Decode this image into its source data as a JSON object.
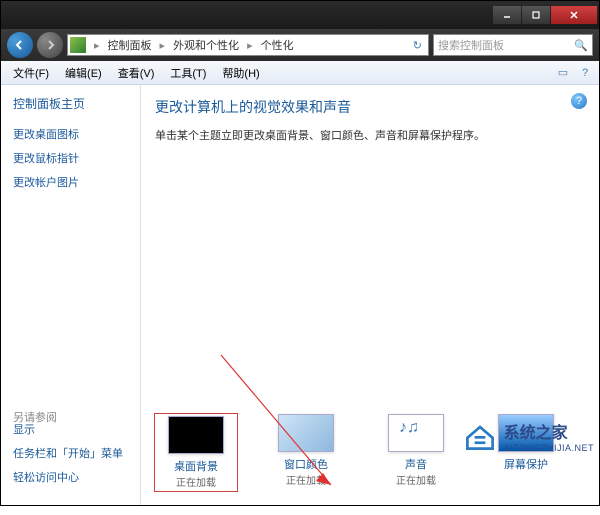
{
  "titlebar": {},
  "nav": {
    "breadcrumb": {
      "root_icon": "control-panel",
      "items": [
        "控制面板",
        "外观和个性化",
        "个性化"
      ]
    },
    "search_placeholder": "搜索控制面板"
  },
  "menubar": {
    "items": [
      "文件(F)",
      "编辑(E)",
      "查看(V)",
      "工具(T)",
      "帮助(H)"
    ]
  },
  "sidebar": {
    "home": "控制面板主页",
    "links": [
      "更改桌面图标",
      "更改鼠标指针",
      "更改帐户图片"
    ],
    "see_also_label": "另请参阅",
    "see_also": [
      "显示",
      "任务栏和「开始」菜单",
      "轻松访问中心"
    ]
  },
  "main": {
    "heading": "更改计算机上的视觉效果和声音",
    "description": "单击某个主题立即更改桌面背景、窗口颜色、声音和屏幕保护程序。",
    "tiles": [
      {
        "label": "桌面背景",
        "status": "正在加载"
      },
      {
        "label": "窗口颜色",
        "status": "正在加载"
      },
      {
        "label": "声音",
        "status": "正在加载"
      },
      {
        "label": "屏幕保护",
        "status": ""
      }
    ]
  },
  "watermark": {
    "name": "系统之家",
    "url": "XITONGZHIJIA.NET"
  }
}
